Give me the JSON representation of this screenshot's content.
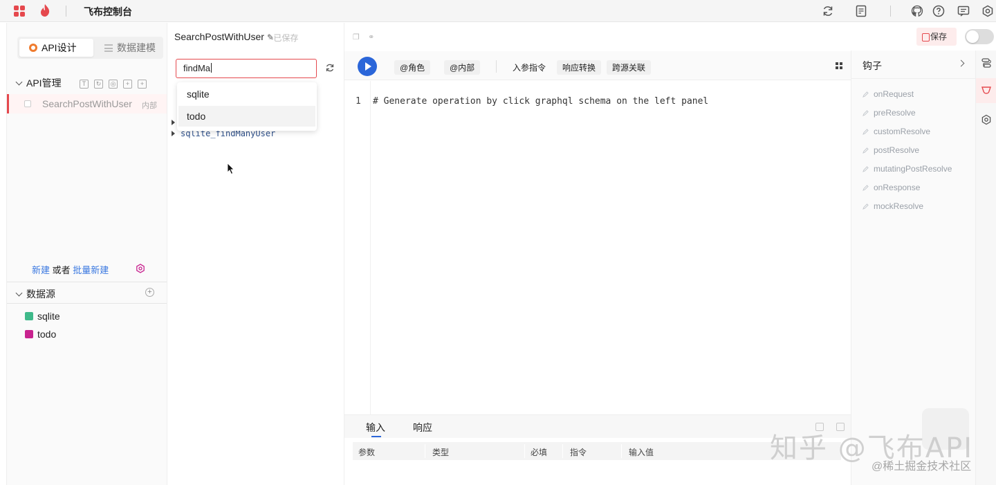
{
  "topbar": {
    "title": "飞布控制台",
    "icons": [
      "grid-icon",
      "flame-logo-icon",
      "refresh-icon",
      "document-icon",
      "github-icon",
      "help-icon",
      "message-icon",
      "settings-icon"
    ]
  },
  "sidebar": {
    "tabs": [
      {
        "label": "API设计",
        "active": true
      },
      {
        "label": "数据建模",
        "active": false
      }
    ],
    "api_section": {
      "title": "API管理",
      "tools": [
        "filter-icon",
        "refresh-icon",
        "target-icon",
        "add-file-icon",
        "add-folder-icon"
      ],
      "items": [
        {
          "name": "SearchPostWithUser",
          "tag": "内部"
        }
      ]
    },
    "create": {
      "new_label": "新建",
      "or_label": "或者",
      "batch_label": "批量新建"
    },
    "datasource_section": {
      "title": "数据源",
      "items": [
        {
          "name": "sqlite",
          "color": "#3fb98a"
        },
        {
          "name": "todo",
          "color": "#c8238f"
        }
      ]
    }
  },
  "operation": {
    "name": "SearchPostWithUser",
    "status": "- 已保存",
    "search_value": "findMa",
    "dropdown": [
      "sqlite",
      "todo"
    ],
    "tree_item": "sqlite_findManyUser"
  },
  "editor": {
    "toolbar": {
      "role_label": "@角色",
      "internal_label": "@内部",
      "input_directive": "入参指令",
      "response_transform": "响应转换",
      "cross_source": "跨源关联"
    },
    "line_number": "1",
    "code": "# Generate operation by click graphql schema on the left panel",
    "bottom_tabs": [
      {
        "label": "输入",
        "active": true
      },
      {
        "label": "响应",
        "active": false
      }
    ],
    "param_columns": [
      "参数",
      "类型",
      "必填",
      "指令",
      "输入值"
    ]
  },
  "actions": {
    "save_label": "保存",
    "toggle_on": false
  },
  "hooks": {
    "title": "钩子",
    "items": [
      "onRequest",
      "preResolve",
      "customResolve",
      "postResolve",
      "mutatingPostResolve",
      "onResponse",
      "mockResolve"
    ]
  },
  "rail": {
    "icons": [
      "flow-icon",
      "hook-icon",
      "gear-icon"
    ],
    "active_index": 1
  },
  "watermark": {
    "line1": "知乎 @飞布API",
    "line2": "@稀土掘金技术社区"
  },
  "colors": {
    "accent": "#e5484d",
    "primary": "#2b66d9",
    "link": "#3a78e0"
  }
}
